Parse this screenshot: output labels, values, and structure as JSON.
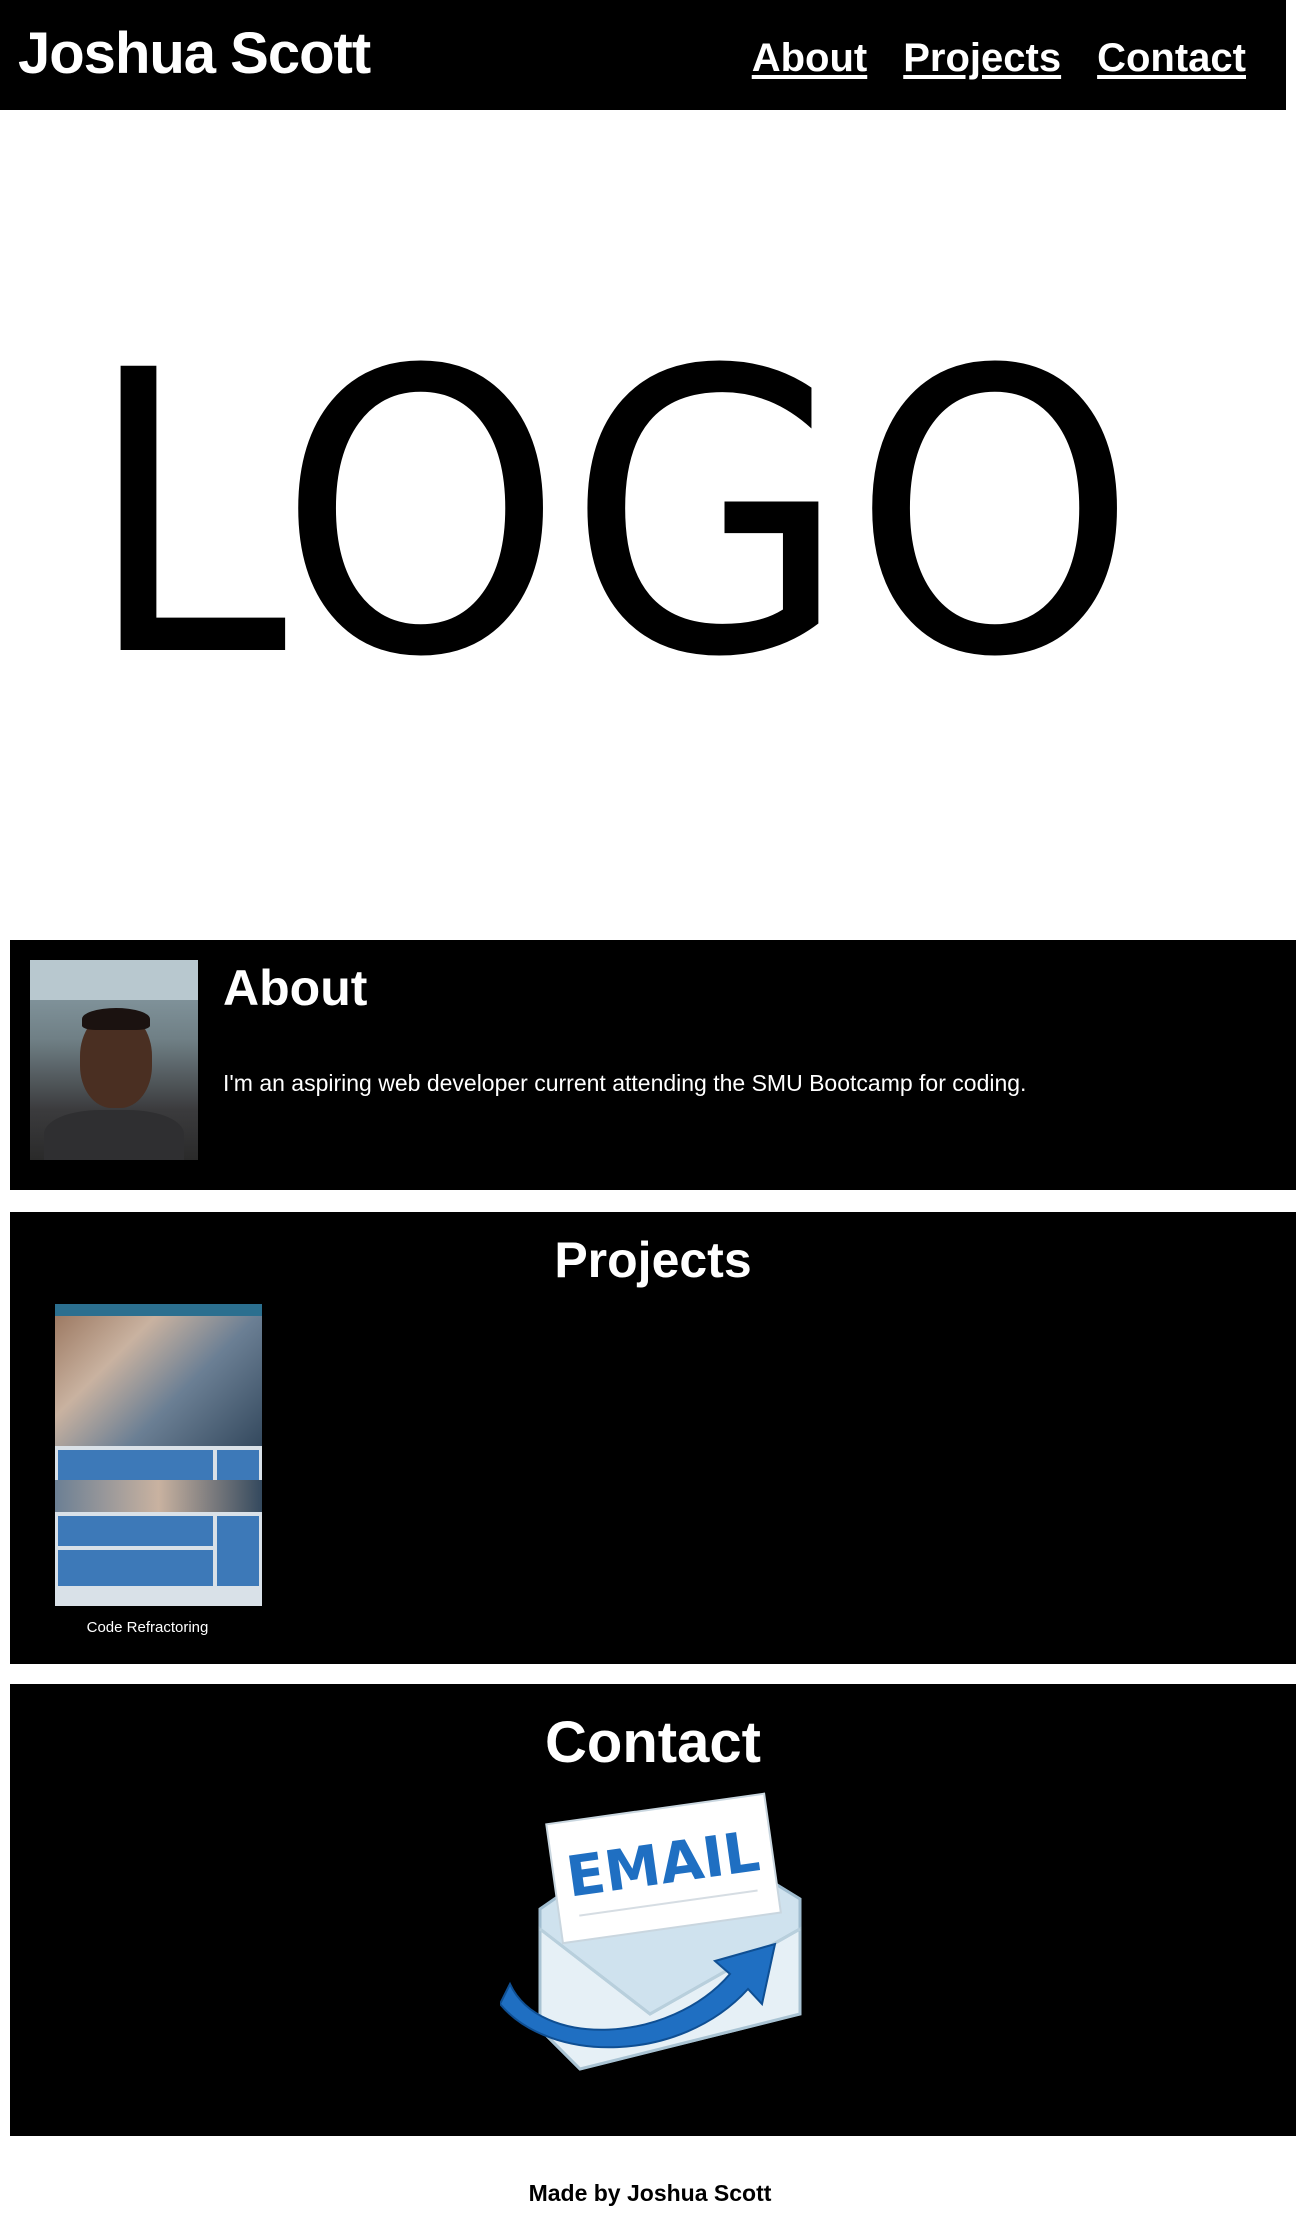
{
  "header": {
    "title": "Joshua Scott",
    "nav": [
      "About",
      "Projects",
      "Contact"
    ]
  },
  "logo": {
    "text": "LOGO"
  },
  "about": {
    "heading": "About",
    "text": "I'm an aspiring web developer current attending the SMU Bootcamp for coding."
  },
  "projects": {
    "heading": "Projects",
    "items": [
      {
        "caption": "Code Refractoring"
      }
    ]
  },
  "contact": {
    "heading": "Contact",
    "email_label": "EMAIL"
  },
  "footer": {
    "text": "Made by Joshua Scott"
  },
  "colors": {
    "panel": "#000000",
    "page": "#ffffff",
    "email_blue": "#1f6fc2"
  }
}
